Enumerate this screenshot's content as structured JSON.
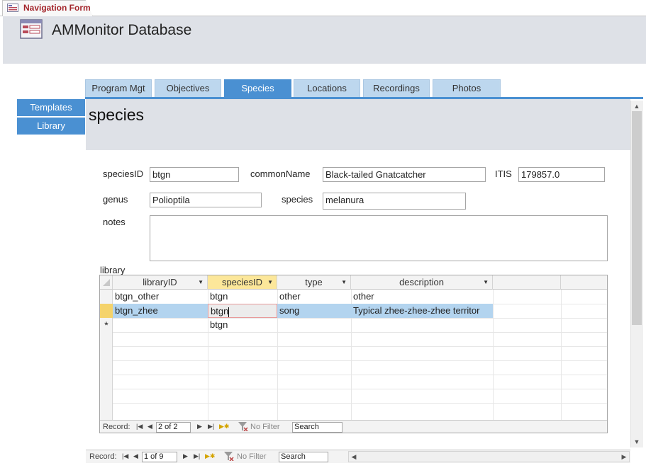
{
  "window": {
    "tab_title": "Navigation Form",
    "header_title": "AMMonitor Database"
  },
  "side_nav": {
    "items": [
      {
        "label": "Templates"
      },
      {
        "label": "Library"
      }
    ]
  },
  "top_tabs": {
    "items": [
      {
        "label": "Program Mgt"
      },
      {
        "label": "Objectives"
      },
      {
        "label": "Species"
      },
      {
        "label": "Locations"
      },
      {
        "label": "Recordings"
      },
      {
        "label": "Photos"
      }
    ],
    "active": "Species"
  },
  "form": {
    "title": "species",
    "speciesID_label": "speciesID",
    "speciesID_value": "btgn",
    "commonName_label": "commonName",
    "commonName_value": "Black-tailed Gnatcatcher",
    "itis_label": "ITIS",
    "itis_value": "179857.0",
    "genus_label": "genus",
    "genus_value": "Polioptila",
    "species_label": "species",
    "species_value": "melanura",
    "notes_label": "notes",
    "notes_value": ""
  },
  "library": {
    "label": "library",
    "columns": [
      "libraryID",
      "speciesID",
      "type",
      "description"
    ],
    "rows": [
      {
        "libraryID": "btgn_other",
        "speciesID": "btgn",
        "type": "other",
        "description": "other"
      },
      {
        "libraryID": "btgn_zhee",
        "speciesID": "btgn",
        "type": "song",
        "description": "Typical zhee-zhee-zhee territor"
      }
    ],
    "new_row_marker": "*",
    "new_row_default_speciesID": "btgn",
    "record_label": "Record:",
    "record_position": "2 of 2",
    "filter_label": "No Filter",
    "search_placeholder": "Search"
  },
  "main_record_bar": {
    "record_label": "Record:",
    "record_position": "1 of 9",
    "filter_label": "No Filter",
    "search_placeholder": "Search"
  },
  "colors": {
    "accent": "#4a90d2",
    "tab_inactive": "#bdd7ee",
    "header_bg": "#dee1e7",
    "selected_row": "#b3d4ef",
    "selected_column": "#fce79a",
    "record_selector": "#f5d36b",
    "title_red": "#a4262c"
  }
}
